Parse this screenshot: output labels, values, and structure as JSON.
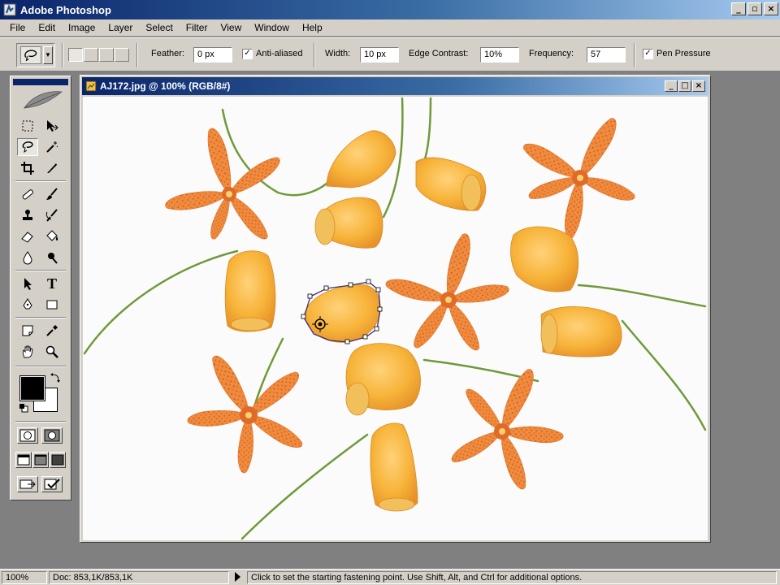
{
  "app": {
    "title": "Adobe Photoshop"
  },
  "window_controls": {
    "minimize": "_",
    "restore": "▫",
    "close": "×"
  },
  "menu": [
    "File",
    "Edit",
    "Image",
    "Layer",
    "Select",
    "Filter",
    "View",
    "Window",
    "Help"
  ],
  "options": {
    "feather_label": "Feather:",
    "feather_value": "0 px",
    "antialiased_label": "Anti-aliased",
    "antialiased_checked": true,
    "width_label": "Width:",
    "width_value": "10 px",
    "edge_contrast_label": "Edge Contrast:",
    "edge_contrast_value": "10%",
    "frequency_label": "Frequency:",
    "frequency_value": "57",
    "pen_pressure_label": "Pen Pressure",
    "pen_pressure_checked": true,
    "check_mark": "✓"
  },
  "document": {
    "title": "AJ172.jpg @ 100% (RGB/8#)",
    "buttons": [
      "_",
      "□",
      "×"
    ]
  },
  "toolbox": {
    "tools": [
      "marquee-tool",
      "move-tool",
      "magnetic-lasso-tool",
      "magic-wand-tool",
      "crop-tool",
      "slice-tool",
      "healing-brush-tool",
      "brush-tool",
      "clone-stamp-tool",
      "history-brush-tool",
      "eraser-tool",
      "paint-bucket-tool",
      "blur-tool",
      "dodge-tool",
      "path-selection-tool",
      "type-tool",
      "pen-tool",
      "rectangle-tool",
      "notes-tool",
      "eyedropper-tool",
      "hand-tool",
      "zoom-tool"
    ],
    "active_tool": "magnetic-lasso-tool",
    "type_glyph": "T",
    "foreground_color": "#000000",
    "background_color": "#ffffff"
  },
  "status": {
    "zoom": "100%",
    "doc_size": "Doc: 853,1K/853,1K",
    "hint": "Click to set the starting fastening point.  Use Shift, Alt, and Ctrl for additional options."
  },
  "colors": {
    "title_gradient_start": "#0a246a",
    "chrome": "#d4d0c8",
    "workspace": "#808080",
    "petal_orange": "#f08a3c",
    "bell_yellow": "#f7b43a",
    "stem_green": "#6f9a3a"
  }
}
